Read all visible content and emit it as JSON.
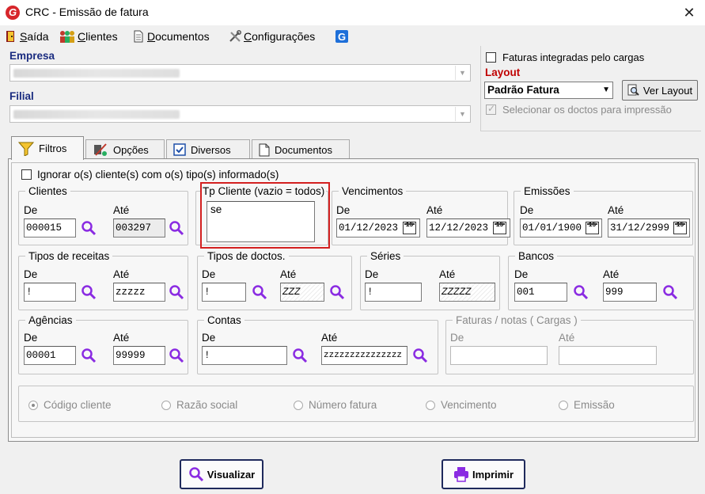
{
  "window": {
    "title": "CRC - Emissão de fatura",
    "close_glyph": "✕"
  },
  "menu": {
    "saida": {
      "accel": "S",
      "rest": "aída"
    },
    "clientes": {
      "accel": "C",
      "rest": "lientes"
    },
    "documentos": {
      "accel": "D",
      "rest": "ocumentos"
    },
    "configuracoes": {
      "accel": "C",
      "rest": "onfigurações"
    }
  },
  "empresa": {
    "label": "Empresa",
    "value": ""
  },
  "filial": {
    "label": "Filial",
    "value": ""
  },
  "right_panel": {
    "faturas_integradas": "Faturas integradas pelo cargas",
    "layout_label": "Layout",
    "layout_value": "Padrão Fatura",
    "ver_layout": "Ver Layout",
    "selecionar": "Selecionar os doctos para impressão"
  },
  "tabs": [
    "Filtros",
    "Opções",
    "Diversos",
    "Documentos"
  ],
  "filters": {
    "ignorar": "Ignorar o(s) cliente(s) com o(s) tipo(s) informado(s)",
    "de": "De",
    "ate": "Até",
    "clientes": {
      "legend": "Clientes",
      "de": "000015",
      "ate": "003297"
    },
    "tp_cliente": {
      "legend": "Tp Cliente (vazio = todos)",
      "value": "se"
    },
    "vencimentos": {
      "legend": "Vencimentos",
      "de": "01/12/2023",
      "ate": "12/12/2023"
    },
    "emissoes": {
      "legend": "Emissões",
      "de": "01/01/1900",
      "ate": "31/12/2999"
    },
    "tipos_receitas": {
      "legend": "Tipos de receitas",
      "de": "!",
      "ate": "zzzzz"
    },
    "tipos_doctos": {
      "legend": "Tipos de doctos.",
      "de": "!",
      "ate": "ZZZ"
    },
    "series": {
      "legend": "Séries",
      "de": "!",
      "ate": "ZZZZZ"
    },
    "bancos": {
      "legend": "Bancos",
      "de": "001",
      "ate": "999"
    },
    "agencias": {
      "legend": "Agências",
      "de": "00001",
      "ate": "99999"
    },
    "contas": {
      "legend": "Contas",
      "de": "!",
      "ate": "zzzzzzzzzzzzzzz"
    },
    "faturas_notas": {
      "legend": "Faturas / notas ( Cargas )",
      "de": "",
      "ate": ""
    },
    "cal_text": "15"
  },
  "ordenacao": [
    "Código cliente",
    "Razão social",
    "Número fatura",
    "Vencimento",
    "Emissão"
  ],
  "buttons": {
    "visualizar": "Visualizar",
    "imprimir": "Imprimir"
  },
  "colors": {
    "accent_label": "#1a2c80",
    "layout_label": "#c00000",
    "highlight": "#d32020",
    "search_icon": "#8a2be2"
  }
}
